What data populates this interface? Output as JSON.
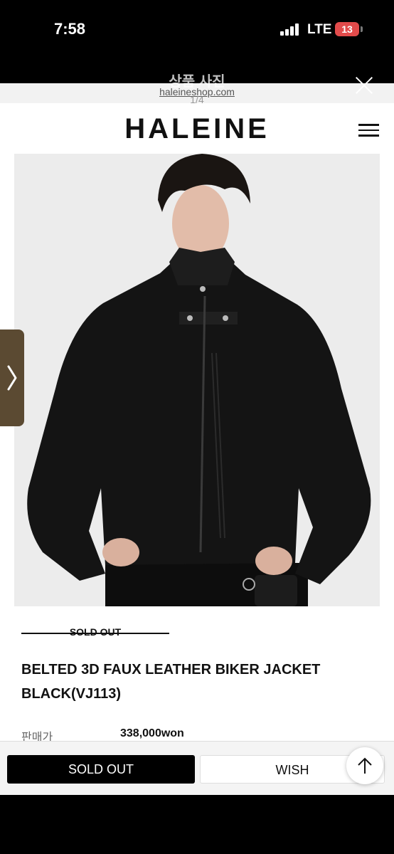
{
  "status_bar": {
    "time": "7:58",
    "network": "LTE",
    "battery": "13",
    "battery_color": "#e24b4b"
  },
  "viewer": {
    "title": "상품 사진",
    "counter": "1/4",
    "close_icon": "close-icon"
  },
  "page": {
    "url": "haleineshop.com",
    "logo": "HALEINE",
    "menu_icon": "hamburger-menu-icon",
    "next_icon": "chevron-right-icon"
  },
  "product": {
    "status": "SOLD OUT",
    "name_line1": "BELTED 3D FAUX LEATHER BIKER JACKET",
    "name_line2": "BLACK(VJ113)",
    "price_label": "판매가",
    "price": "338,000won"
  },
  "actions": {
    "soldout_button": "SOLD OUT",
    "wish_button": "WISH",
    "scroll_top_icon": "arrow-up-icon"
  }
}
